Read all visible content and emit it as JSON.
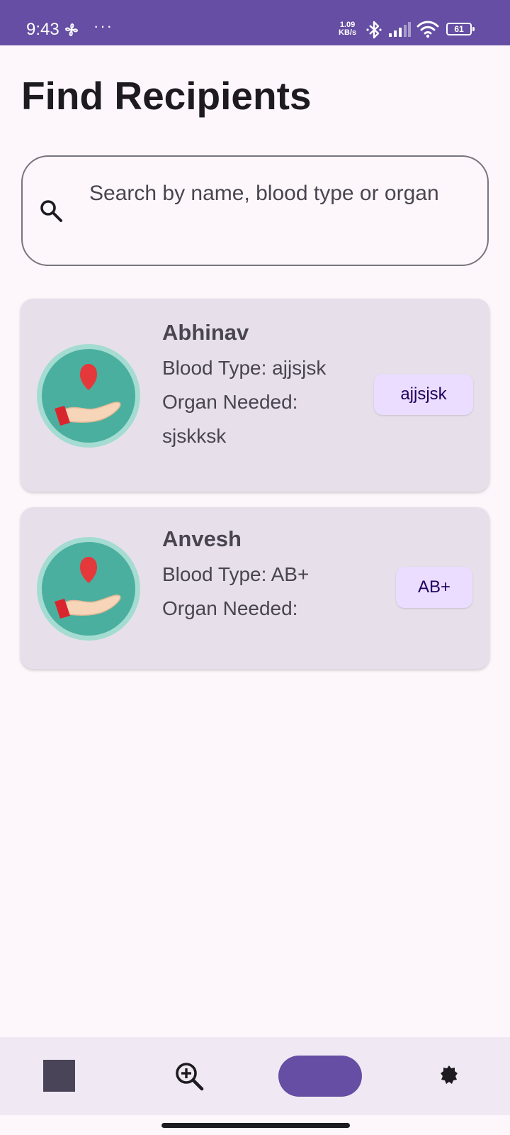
{
  "status_bar": {
    "time": "9:43",
    "dots": "···",
    "speed_value": "1.09",
    "speed_unit": "KB/s",
    "battery": "61",
    "color": "#654ea3"
  },
  "page_title": "Find Recipients",
  "search": {
    "placeholder": "Search by name, blood type or organ",
    "icon": "search-icon"
  },
  "recipients": [
    {
      "name": "Abhinav",
      "blood_line": "Blood Type: ajjsjsk",
      "organ_line": "Organ Needed: sjskksk",
      "badge": "ajjsjsk",
      "avatar_icon": "hand-heart-icon"
    },
    {
      "name": "Anvesh",
      "blood_line": "Blood Type: AB+",
      "organ_line": "Organ Needed:",
      "badge": "AB+",
      "avatar_icon": "hand-heart-icon"
    }
  ],
  "bottom_nav": {
    "items": [
      {
        "icon": "square-icon"
      },
      {
        "icon": "zoom-in-icon"
      },
      {
        "icon": "active-pill"
      },
      {
        "icon": "gear-icon"
      }
    ],
    "accent": "#654ea3"
  },
  "colors": {
    "background": "#fdf7fc",
    "card": "#e7e0eb",
    "chip": "#eaddff",
    "avatar_teal": "#4aaf9f",
    "heart_red": "#e5383b"
  }
}
